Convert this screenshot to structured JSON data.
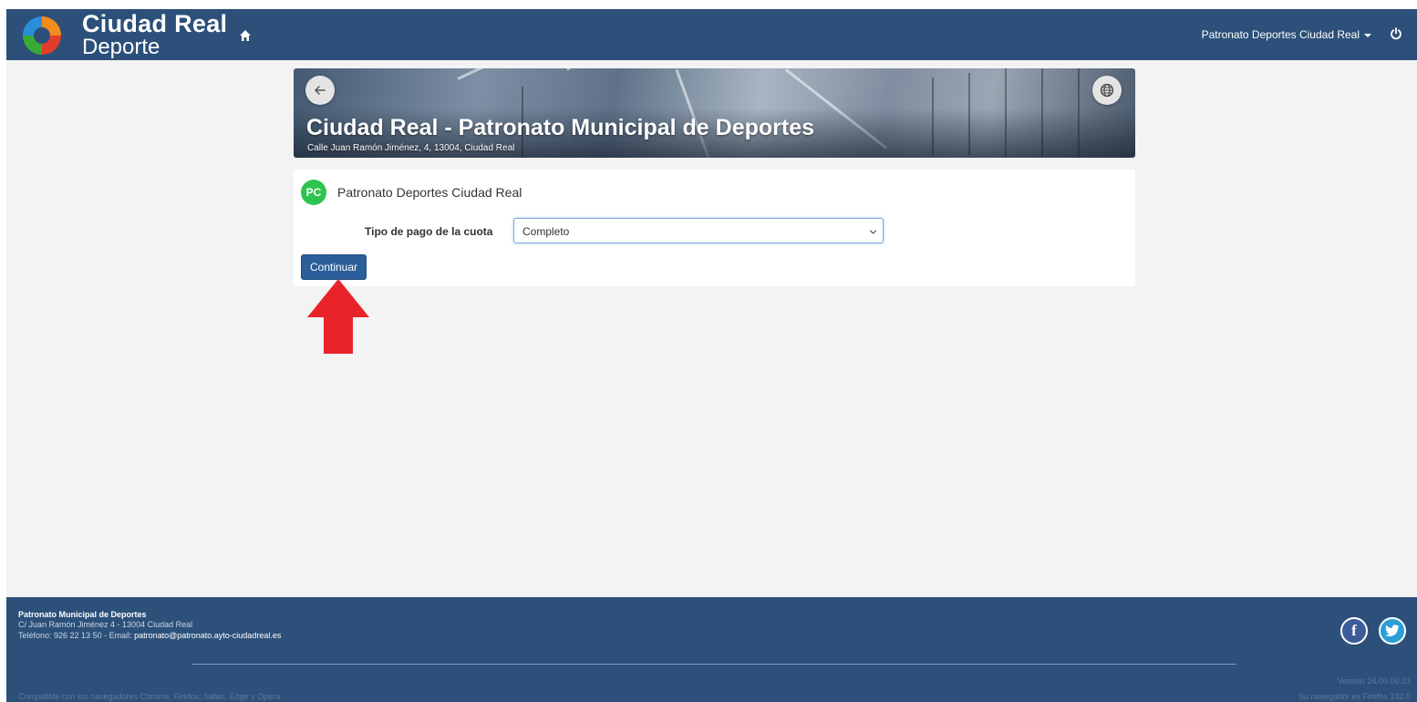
{
  "header": {
    "brand_title": "Ciudad Real",
    "brand_subtitle": "Deporte",
    "user_menu_label": "Patronato Deportes Ciudad Real"
  },
  "banner": {
    "title": "Ciudad Real - Patronato Municipal de Deportes",
    "address": "Calle Juan Ramón Jiménez, 4, 13004, Ciudad Real"
  },
  "form": {
    "avatar_initials": "PC",
    "entity_name": "Patronato Deportes Ciudad Real",
    "payment_type_label": "Tipo de pago de la cuota",
    "payment_type_value": "Completo",
    "continue_label": "Continuar"
  },
  "footer": {
    "title": "Patronato Municipal de Deportes",
    "address": "C/ Juan Ramón Jiménez 4 - 13004 Ciudad Real",
    "phone_prefix": "Teléfono: 926 22 13 50 - Email: ",
    "email": "patronato@patronato.ayto-ciudadreal.es",
    "version": "Versión 24.00.00.03",
    "compat_note": "Compatible con los navegadores Chrome, Firefox, Safari, Edge y Opera",
    "browser_note": "Su navegador es Firefox 132.0",
    "facebook_glyph": "f"
  },
  "colors": {
    "navbar": "#2c5079",
    "button_primary": "#2c5f9a",
    "avatar_green": "#2ec44f",
    "annotation_arrow": "#e8232a"
  },
  "icons": [
    "home-icon",
    "chevron-down-icon",
    "power-icon",
    "arrow-left-icon",
    "globe-icon",
    "facebook-icon",
    "twitter-icon"
  ]
}
